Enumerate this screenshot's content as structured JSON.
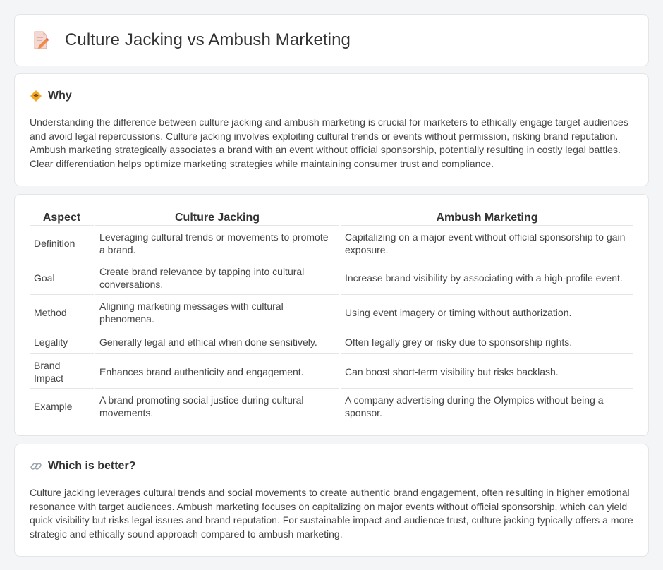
{
  "header": {
    "title": "Culture Jacking vs Ambush Marketing",
    "icon": "document-pencil-icon"
  },
  "why": {
    "icon": "diamond-warning-icon",
    "title": "Why",
    "text": "Understanding the difference between culture jacking and ambush marketing is crucial for marketers to ethically engage target audiences and avoid legal repercussions. Culture jacking involves exploiting cultural trends or events without permission, risking brand reputation. Ambush marketing strategically associates a brand with an event without official sponsorship, potentially resulting in costly legal battles. Clear differentiation helps optimize marketing strategies while maintaining consumer trust and compliance."
  },
  "table": {
    "headers": [
      "Aspect",
      "Culture Jacking",
      "Ambush Marketing"
    ],
    "rows": [
      [
        "Definition",
        "Leveraging cultural trends or movements to promote a brand.",
        "Capitalizing on a major event without official sponsorship to gain exposure."
      ],
      [
        "Goal",
        "Create brand relevance by tapping into cultural conversations.",
        "Increase brand visibility by associating with a high-profile event."
      ],
      [
        "Method",
        "Aligning marketing messages with cultural phenomena.",
        "Using event imagery or timing without authorization."
      ],
      [
        "Legality",
        "Generally legal and ethical when done sensitively.",
        "Often legally grey or risky due to sponsorship rights."
      ],
      [
        "Brand Impact",
        "Enhances brand authenticity and engagement.",
        "Can boost short-term visibility but risks backlash."
      ],
      [
        "Example",
        "A brand promoting social justice during cultural movements.",
        "A company advertising during the Olympics without being a sponsor."
      ]
    ]
  },
  "better": {
    "icon": "link-icon",
    "title": "Which is better?",
    "text": "Culture jacking leverages cultural trends and social movements to create authentic brand engagement, often resulting in higher emotional resonance with target audiences. Ambush marketing focuses on capitalizing on major events without official sponsorship, which can yield quick visibility but risks legal issues and brand reputation. For sustainable impact and audience trust, culture jacking typically offers a more strategic and ethically sound approach compared to ambush marketing."
  }
}
